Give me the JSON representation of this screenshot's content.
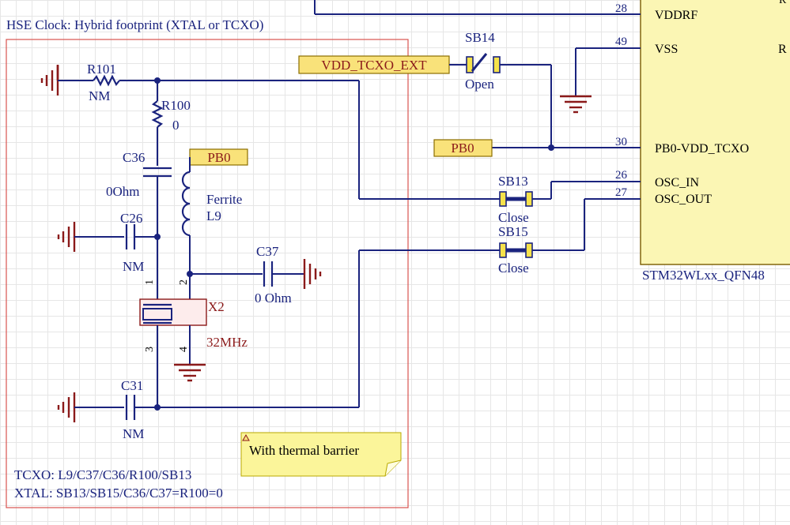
{
  "block_title": "HSE Clock: Hybrid footprint (XTAL or TCXO)",
  "components": {
    "r101": {
      "ref": "R101",
      "value": "NM"
    },
    "r100": {
      "ref": "R100",
      "value": "0"
    },
    "c36": {
      "ref": "C36",
      "value": "0Ohm"
    },
    "c26": {
      "ref": "C26",
      "value": "NM"
    },
    "c31": {
      "ref": "C31",
      "value": "NM"
    },
    "c37": {
      "ref": "C37",
      "value": "0 Ohm"
    },
    "l9": {
      "ref": "L9",
      "value": "Ferrite"
    },
    "x2": {
      "ref": "X2",
      "value": "32MHz",
      "pins": [
        "1",
        "2",
        "3",
        "4"
      ]
    }
  },
  "net_labels": {
    "pb0_inner": "PB0",
    "vdd_tcxo_ext": "VDD_TCXO_EXT",
    "pb0_outer": "PB0"
  },
  "solder_bridges": {
    "sb14": {
      "ref": "SB14",
      "state": "Open"
    },
    "sb13": {
      "ref": "SB13",
      "state": "Close"
    },
    "sb15": {
      "ref": "SB15",
      "state": "Close"
    }
  },
  "mcu": {
    "part": "STM32WLxx_QFN48",
    "pins": [
      {
        "num": "28",
        "name": "VDDRF"
      },
      {
        "num": "49",
        "name": "VSS"
      },
      {
        "num": "30",
        "name": "PB0-VDD_TCXO"
      },
      {
        "num": "26",
        "name": "OSC_IN"
      },
      {
        "num": "27",
        "name": "OSC_OUT"
      }
    ],
    "cut_text_top": "R",
    "cut_text_right": "R"
  },
  "note": "With thermal barrier",
  "footer": {
    "line1": "TCXO: L9/C37/C36/R100/SB13",
    "line2": "XTAL: SB13/SB15/C36/C37=R100=0"
  },
  "colors": {
    "wire": "#1a237e",
    "ground": "#8b1a1a",
    "net_label_fill": "#f9e27a",
    "border": "#d9534f",
    "mcu_fill": "#fbf6b4",
    "note_fill": "#fbf59a"
  }
}
